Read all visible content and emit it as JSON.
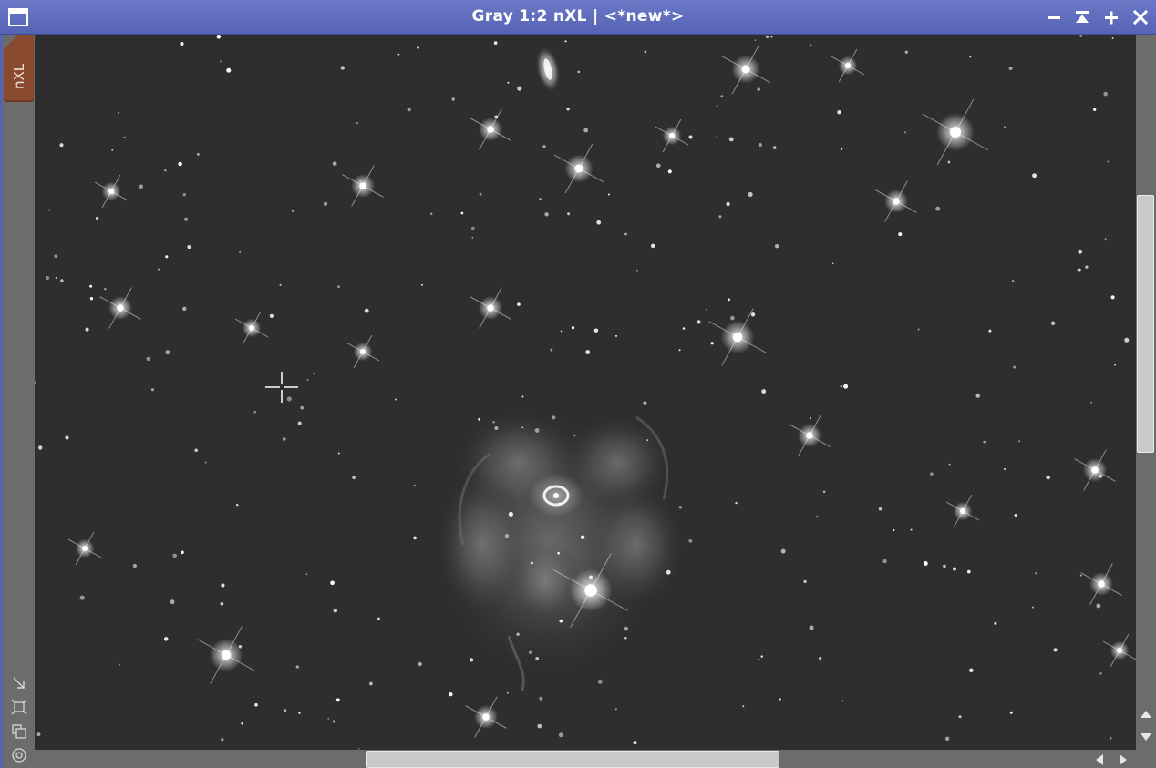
{
  "window": {
    "title": "Gray 1:2 nXL | <*new*>",
    "title_bar_color": "#5764b4"
  },
  "title_buttons": [
    {
      "name": "minimize-icon"
    },
    {
      "name": "shade-icon"
    },
    {
      "name": "maximize-icon"
    },
    {
      "name": "close-icon"
    }
  ],
  "side_tab": {
    "label": "nXL",
    "color": "#8a4a2f"
  },
  "side_tools": [
    {
      "name": "fit-view-icon"
    },
    {
      "name": "zoom-to-fit-icon"
    },
    {
      "name": "clone-view-icon"
    },
    {
      "name": "target-icon"
    }
  ],
  "image": {
    "subject": "grayscale deep-sky image: planetary nebula with faint surrounding nebulosity, star field, edge-on spiral galaxy",
    "colors": {
      "sky": "#2e2e2e",
      "stars": "#ffffff",
      "nebula": "#8a8a8a"
    }
  },
  "scrollbars": {
    "vertical": {
      "up": "scroll-up-icon",
      "down": "scroll-down-icon"
    },
    "horizontal": {
      "left": "scroll-left-icon",
      "right": "scroll-right-icon"
    }
  }
}
